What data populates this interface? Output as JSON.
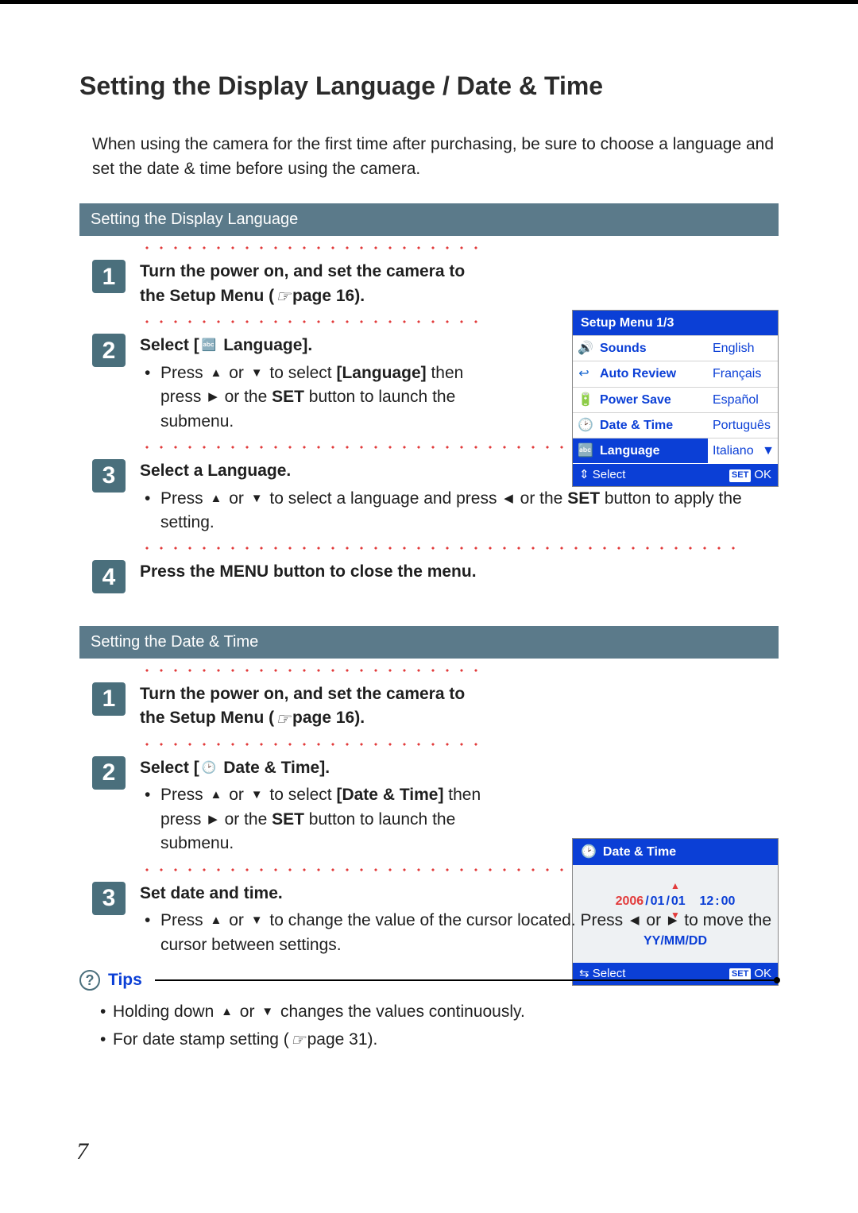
{
  "title": "Setting the Display Language / Date & Time",
  "intro": "When using the camera for the first time after purchasing, be sure to choose a language and set the date & time before using the camera.",
  "bands": {
    "language": "Setting the Display Language",
    "datetime": "Setting the Date & Time"
  },
  "lang_steps": {
    "s1a": "Turn the power on, and set the camera to the Setup Menu (",
    "s1b": "page 16).",
    "s2a": "Select [",
    "s2b": " Language].",
    "s2c_a": "Press ",
    "s2c_b": " or ",
    "s2c_c": " to select ",
    "s2c_d": "[Language]",
    "s2c_e": " then press ",
    "s2c_f": " or the ",
    "s2c_g": "SET",
    "s2c_h": " button to launch the submenu.",
    "s3a": "Select a Language.",
    "s3b_a": "Press ",
    "s3b_b": " or ",
    "s3b_c": " to select a language and press ",
    "s3b_d": " or the ",
    "s3b_e": "SET",
    "s3b_f": " button to apply the setting.",
    "s4": "Press the MENU button to close the menu."
  },
  "dt_steps": {
    "s1a": "Turn the power on, and set the camera to the Setup Menu (",
    "s1b": "page 16).",
    "s2a": "Select [",
    "s2b": " Date & Time].",
    "s2c_a": "Press ",
    "s2c_b": " or ",
    "s2c_c": " to select ",
    "s2c_d": "[Date & Time]",
    "s2c_e": " then press ",
    "s2c_f": " or the ",
    "s2c_g": "SET",
    "s2c_h": " button to launch the submenu.",
    "s3a": "Set date and time.",
    "s3b_a": "Press ",
    "s3b_b": " or ",
    "s3b_c": " to change the value of the cursor located. Press ",
    "s3b_d": " or ",
    "s3b_e": " to move the cursor between settings."
  },
  "tips": {
    "label": "Tips",
    "t1a": "Holding down ",
    "t1b": " or ",
    "t1c": " changes the values continuously.",
    "t2a": "For date stamp setting (",
    "t2b": "page 31)."
  },
  "lcd_setup": {
    "title": "Setup Menu 1/3",
    "rows": [
      {
        "icon": "🔊",
        "label": "Sounds",
        "lang": "English"
      },
      {
        "icon": "↩",
        "label": "Auto Review",
        "lang": "Français"
      },
      {
        "icon": "🔋",
        "label": "Power Save",
        "lang": "Español"
      },
      {
        "icon": "🕑",
        "label": "Date & Time",
        "lang": "Português"
      },
      {
        "icon": "🔤",
        "label": "Language",
        "lang": "Italiano",
        "selected": true
      }
    ],
    "footer_left": "Select",
    "footer_right": "OK"
  },
  "lcd_dt": {
    "title": "Date & Time",
    "year": "2006",
    "month": "01",
    "day": "01",
    "hour": "12",
    "minute": "00",
    "format": "YY/MM/DD",
    "footer_left": "Select",
    "footer_right": "OK"
  },
  "page_number": "7"
}
